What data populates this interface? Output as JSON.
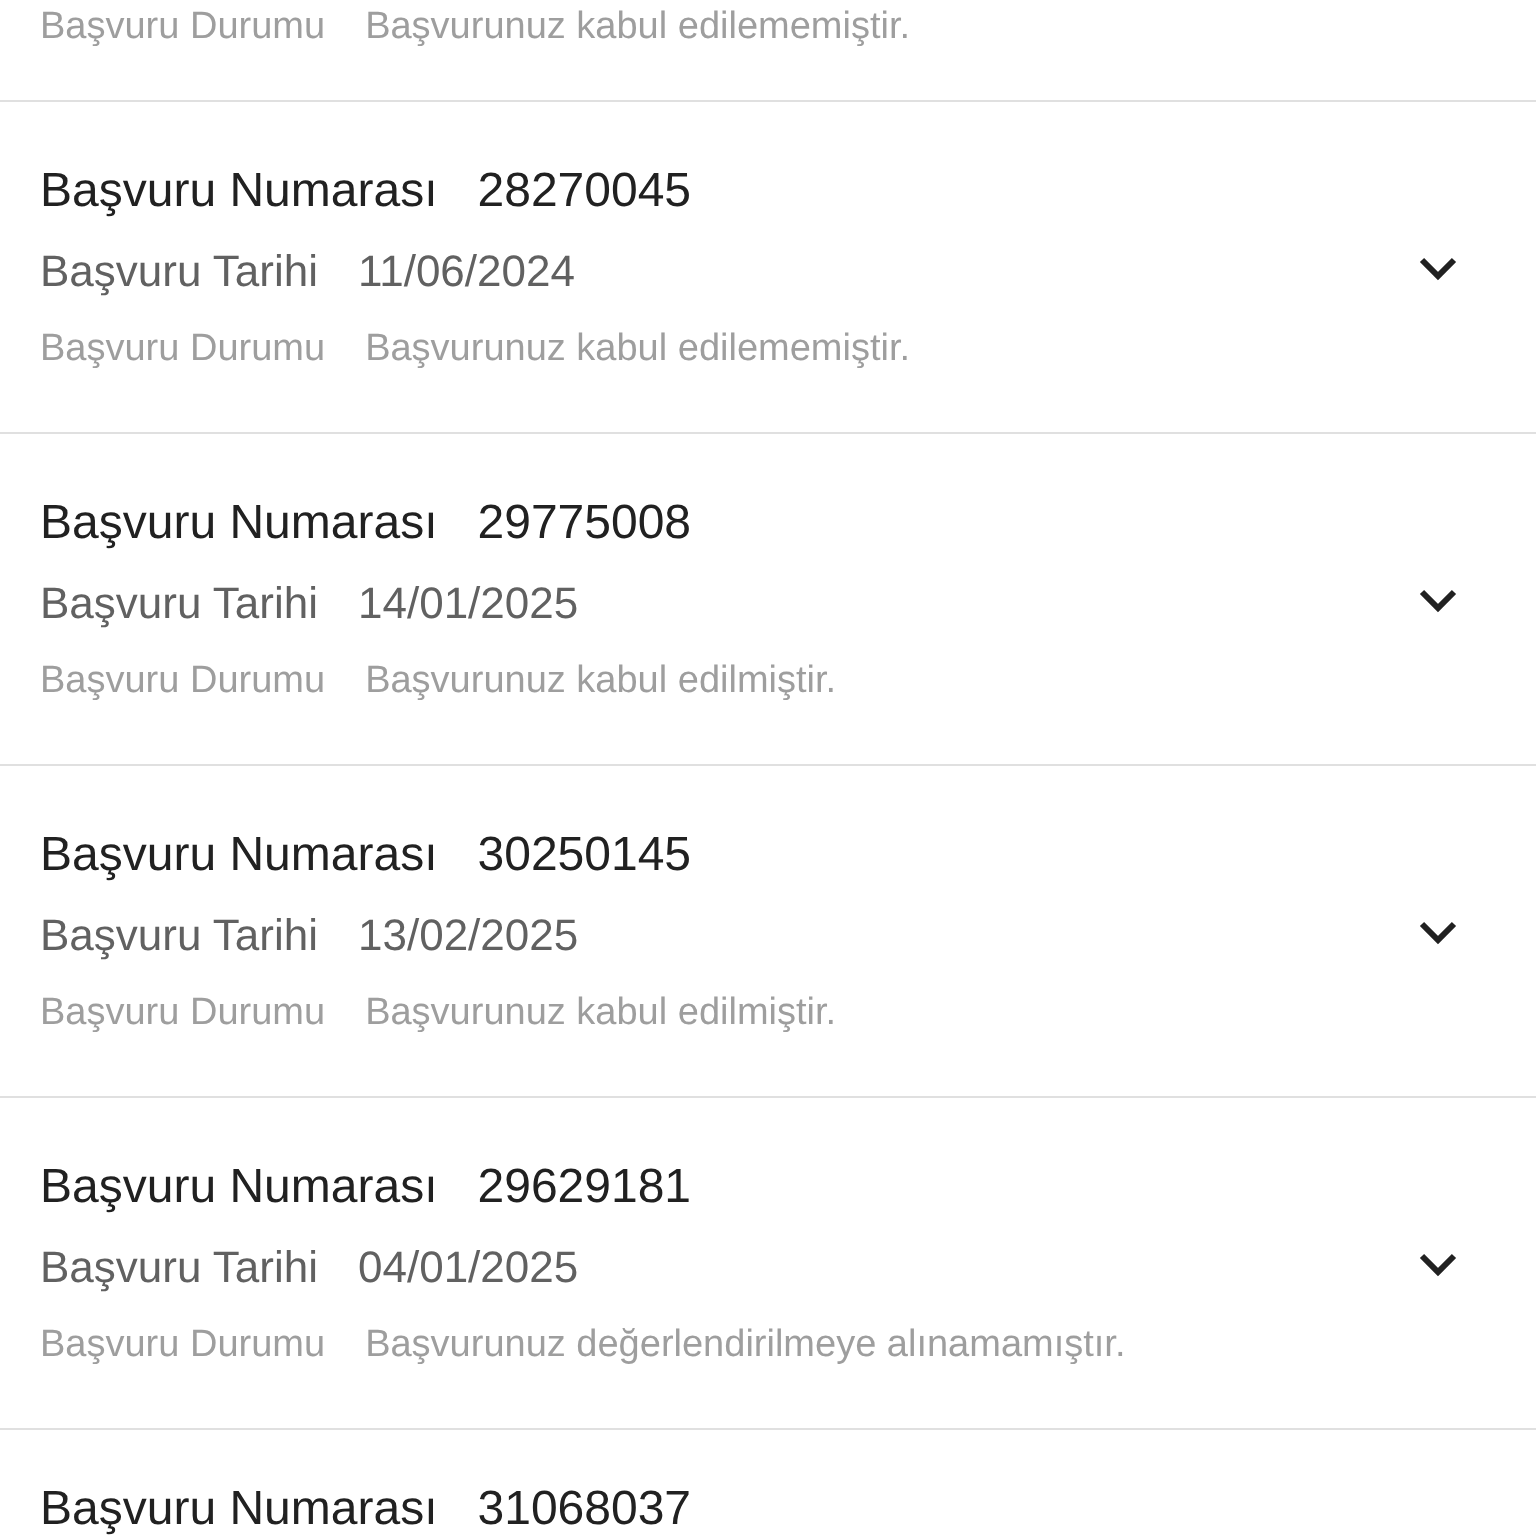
{
  "applications": [
    {
      "status_label": "Başvuru Durumu",
      "status": "Başvurunuz kabul edilememiştir."
    },
    {
      "number_label": "Başvuru Numarası",
      "number": "28270045",
      "date_label": "Başvuru Tarihi",
      "date": "11/06/2024",
      "status_label": "Başvuru Durumu",
      "status": "Başvurunuz kabul edilememiştir.",
      "expanded": false
    },
    {
      "number_label": "Başvuru Numarası",
      "number": "29775008",
      "date_label": "Başvuru Tarihi",
      "date": "14/01/2025",
      "status_label": "Başvuru Durumu",
      "status": "Başvurunuz kabul edilmiştir.",
      "expanded": false
    },
    {
      "number_label": "Başvuru Numarası",
      "number": "30250145",
      "date_label": "Başvuru Tarihi",
      "date": "13/02/2025",
      "status_label": "Başvuru Durumu",
      "status": "Başvurunuz kabul edilmiştir.",
      "expanded": false
    },
    {
      "number_label": "Başvuru Numarası",
      "number": "29629181",
      "date_label": "Başvuru Tarihi",
      "date": "04/01/2025",
      "status_label": "Başvuru Durumu",
      "status": "Başvurunuz değerlendirilmeye alınamamıştır.",
      "expanded": false
    },
    {
      "number_label": "Başvuru Numarası",
      "number": "31068037"
    }
  ]
}
